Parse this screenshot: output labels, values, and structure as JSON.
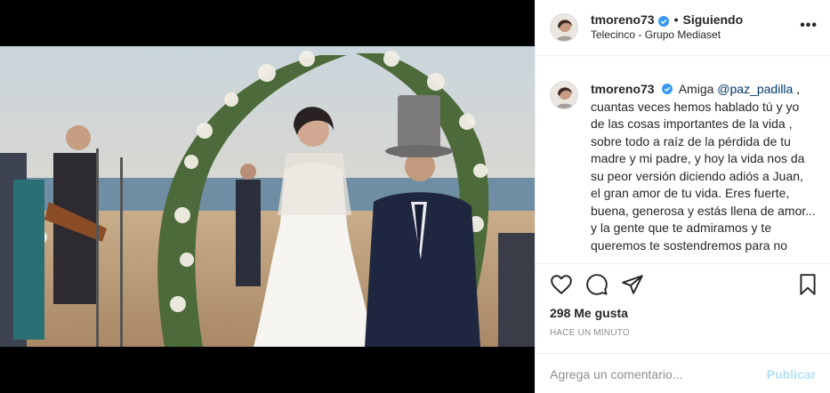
{
  "post": {
    "username": "tmoreno73",
    "verified_icon": "verified-badge-icon",
    "separator": "•",
    "follow_status": "Siguiendo",
    "location": "Telecinco - Grupo Mediaset",
    "more_icon": "more-options-icon",
    "more_label": "•••"
  },
  "caption": {
    "username": "tmoreno73",
    "intro": "Amiga",
    "mention": "@paz_padilla",
    "body": ", cuantas veces hemos hablado tú y yo de las cosas importantes de la vida , sobre todo a raíz de la pérdida de tu madre y mi padre, y hoy la vida nos da su peor versión diciendo adiós a Juan, el gran amor de tu vida. Eres fuerte, buena, generosa y estás llena de amor... y la gente que te admiramos y te queremos te sostendremos para no dejarte caer. Amiga, no sabes como me"
  },
  "actions": {
    "like_icon": "heart-icon",
    "comment_icon": "comment-bubble-icon",
    "share_icon": "share-paper-plane-icon",
    "save_icon": "bookmark-icon",
    "likes": "298 Me gusta",
    "timestamp": "HACE UN MINUTO"
  },
  "comment": {
    "placeholder": "Agrega un comentario...",
    "publish_label": "Publicar"
  },
  "colors": {
    "link": "#00376b",
    "verified": "#3897f0",
    "publish_disabled": "#b2dffc",
    "muted": "#8e8e8e"
  }
}
